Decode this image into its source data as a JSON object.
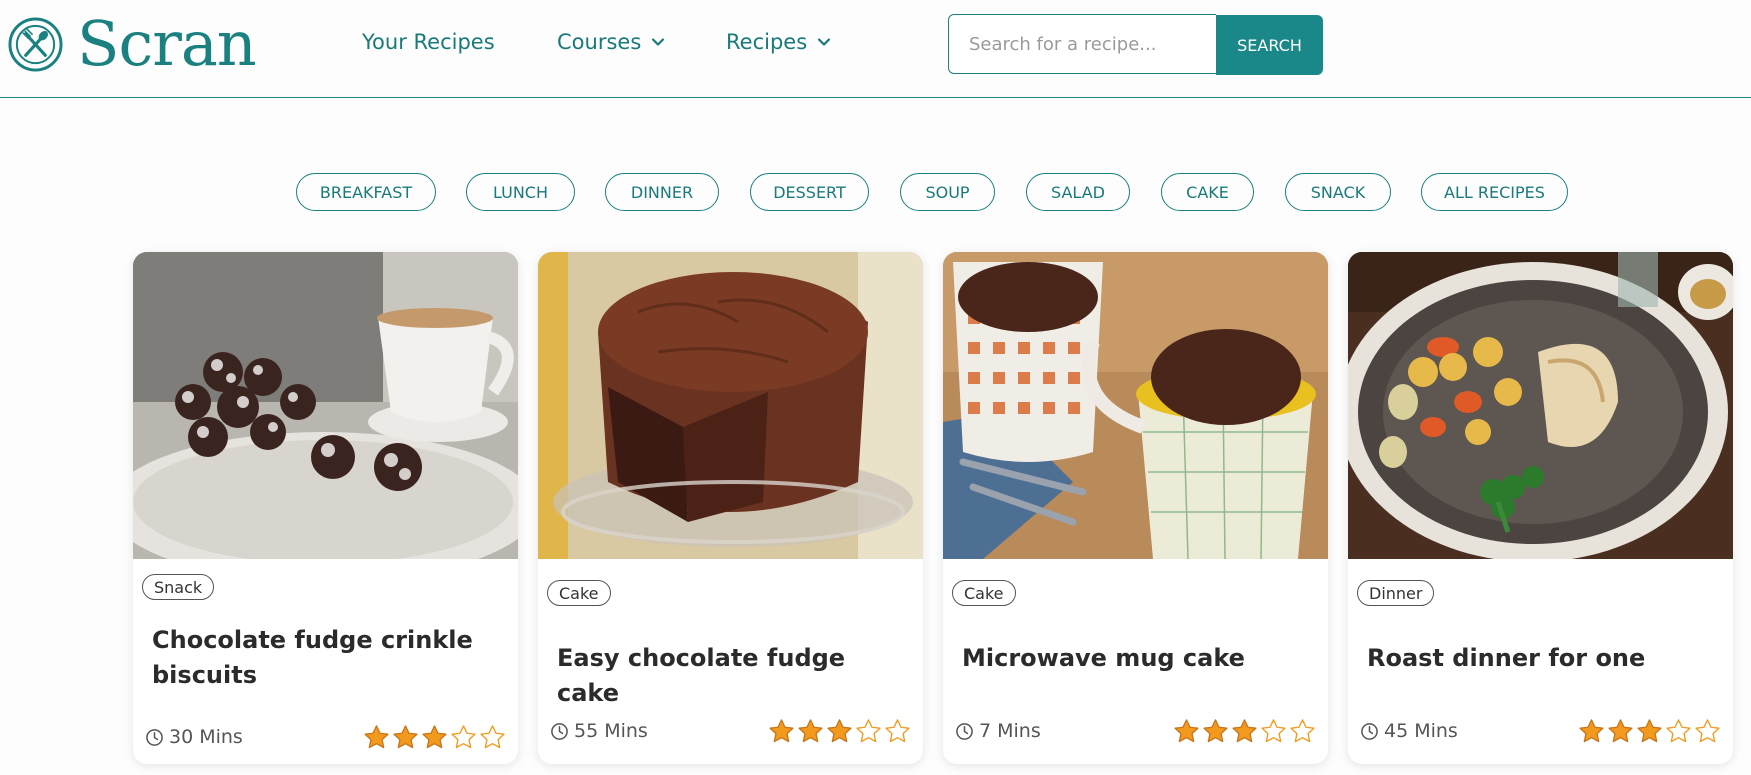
{
  "brand": {
    "name": "Scran",
    "color": "#1a8080"
  },
  "nav": {
    "your_recipes": "Your Recipes",
    "courses": "Courses",
    "recipes": "Recipes"
  },
  "search": {
    "placeholder": "Search for a recipe...",
    "button_label": "SEARCH"
  },
  "categories": [
    "BREAKFAST",
    "LUNCH",
    "DINNER",
    "DESSERT",
    "SOUP",
    "SALAD",
    "CAKE",
    "SNACK",
    "ALL RECIPES"
  ],
  "cards": [
    {
      "tag": "Snack",
      "title": "Chocolate fudge crinkle biscuits",
      "time": "30 Mins",
      "rating": 3,
      "rating_max": 5,
      "image": "chocolate-crinkle-biscuits-with-coffee"
    },
    {
      "tag": "Cake",
      "title": "Easy chocolate fudge cake",
      "time": "55 Mins",
      "rating": 3,
      "rating_max": 5,
      "image": "chocolate-fudge-cake-on-glass-stand"
    },
    {
      "tag": "Cake",
      "title": "Microwave mug cake",
      "time": "7 Mins",
      "rating": 3,
      "rating_max": 5,
      "image": "chocolate-mug-cakes"
    },
    {
      "tag": "Dinner",
      "title": "Roast dinner for one",
      "time": "45 Mins",
      "rating": 3,
      "rating_max": 5,
      "image": "roast-chicken-vegetables-plate"
    }
  ],
  "colors": {
    "accent": "#1a8888",
    "star": "#f29a1e"
  }
}
